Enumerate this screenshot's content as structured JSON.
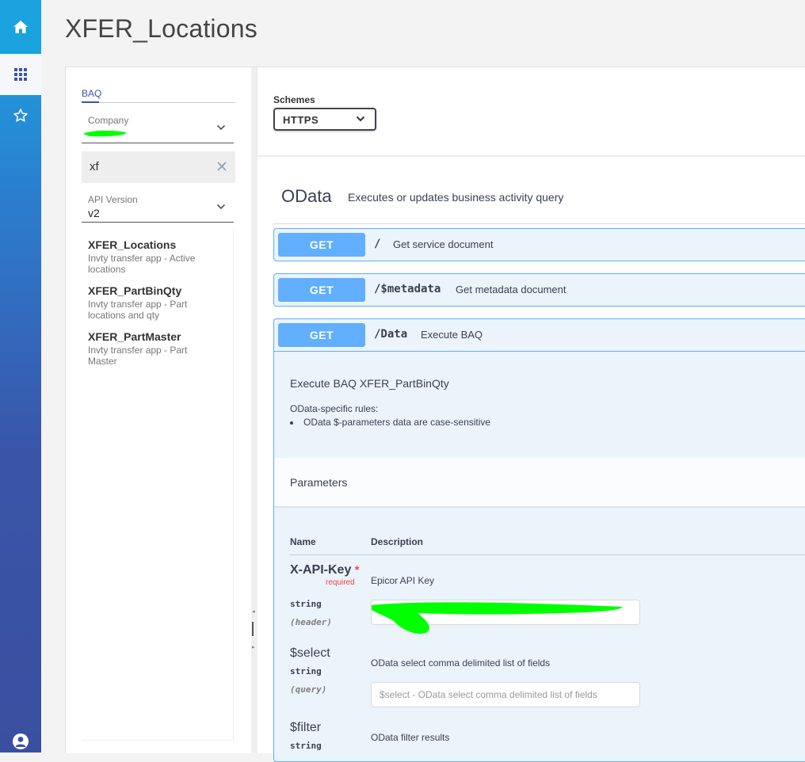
{
  "page": {
    "title": "XFER_Locations"
  },
  "rail": {
    "icons": [
      "home-icon",
      "apps-grid-icon",
      "star-icon",
      "user-icon"
    ]
  },
  "sidebar": {
    "tab_label": "BAQ",
    "company": {
      "label": "Company",
      "value": ""
    },
    "search": {
      "value": "xf"
    },
    "api_version": {
      "label": "API Version",
      "value": "v2"
    },
    "items": [
      {
        "title": "XFER_Locations",
        "desc": "Invty transfer app - Active locations"
      },
      {
        "title": "XFER_PartBinQty",
        "desc": "Invty transfer app - Part locations and qty"
      },
      {
        "title": "XFER_PartMaster",
        "desc": "Invty transfer app - Part Master"
      }
    ]
  },
  "schemes": {
    "label": "Schemes",
    "value": "HTTPS"
  },
  "odata": {
    "title": "OData",
    "desc": "Executes or updates business activity query"
  },
  "operations": [
    {
      "method": "GET",
      "path": "/",
      "summary": "Get service document"
    },
    {
      "method": "GET",
      "path": "/$metadata",
      "summary": "Get metadata document"
    },
    {
      "method": "GET",
      "path": "/Data",
      "summary": "Execute BAQ"
    }
  ],
  "expanded": {
    "exec_title": "Execute BAQ XFER_PartBinQty",
    "rules_label": "OData-specific rules:",
    "rules": [
      "OData $-parameters data are case-sensitive"
    ],
    "parameters_label": "Parameters",
    "col_name": "Name",
    "col_desc": "Description",
    "params": [
      {
        "name": "X-API-Key",
        "required_star": "*",
        "required_text": "required",
        "type": "string",
        "in": "(header)",
        "desc": "Epicor API Key",
        "value": ""
      },
      {
        "name": "$select",
        "type": "string",
        "in": "(query)",
        "desc": "OData select comma delimited list of fields",
        "placeholder": "$select - OData select comma delimited list of fields"
      },
      {
        "name": "$filter",
        "type": "string",
        "desc": "OData filter results"
      }
    ]
  },
  "colors": {
    "get": "#61affe",
    "get_bg": "#ebf3fb",
    "accent": "#3a55a8",
    "required": "#f93e3e",
    "redaction": "#00ff00"
  }
}
